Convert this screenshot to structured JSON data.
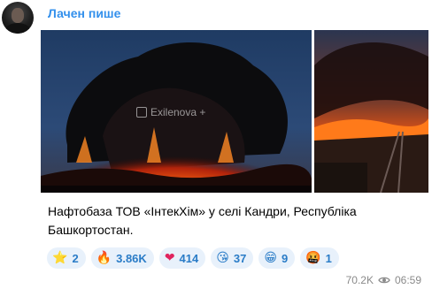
{
  "channel": {
    "author": "Лачен пише"
  },
  "media": {
    "watermark": "Exilenova +"
  },
  "post": {
    "text": "Нафтобаза ТОВ «ІнтекХім» у селі Кандри, Республіка Башкортостан."
  },
  "reactions": [
    {
      "icon": "star-icon",
      "glyph": "⭐",
      "count": "2"
    },
    {
      "icon": "fire-icon",
      "glyph": "🔥",
      "count": "3.86K"
    },
    {
      "icon": "heart-icon",
      "glyph": "❤",
      "count": "414"
    },
    {
      "icon": "kiss-icon",
      "glyph": "😘",
      "count": "37"
    },
    {
      "icon": "grin-icon",
      "glyph": "😁",
      "count": "9"
    },
    {
      "icon": "angry-icon",
      "glyph": "🤬",
      "count": "1"
    }
  ],
  "meta": {
    "views": "70.2K",
    "time": "06:59"
  },
  "colors": {
    "accent": "#3390ec",
    "reaction_bg": "#e8f1fb",
    "reaction_text": "#2a7cc7"
  }
}
